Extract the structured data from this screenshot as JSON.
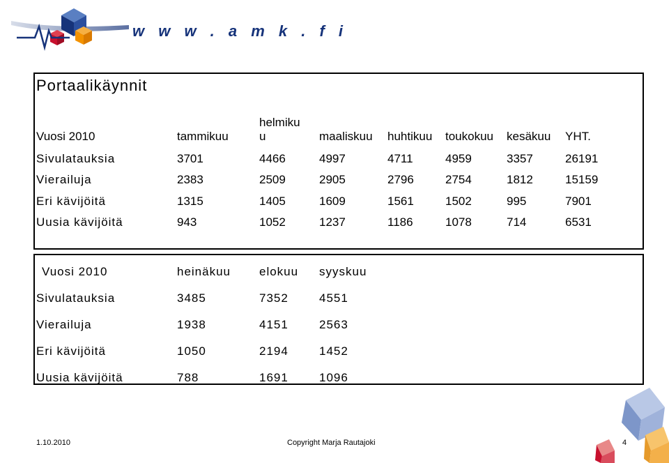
{
  "header": {
    "url": "w w w . a m k . f i"
  },
  "title": "Portaalikäynnit",
  "table1": {
    "headers": [
      "Vuosi 2010",
      "tammikuu",
      "helmiku\nu",
      "maaliskuu",
      "huhtikuu",
      "toukokuu",
      "kesäkuu",
      "YHT."
    ],
    "rows": [
      [
        "Sivulatauksia",
        "3701",
        "4466",
        "4997",
        "4711",
        "4959",
        "3357",
        "26191"
      ],
      [
        "Vierailuja",
        "2383",
        "2509",
        "2905",
        "2796",
        "2754",
        "1812",
        "15159"
      ],
      [
        "Eri kävijöitä",
        "1315",
        "1405",
        "1609",
        "1561",
        "1502",
        "995",
        "7901"
      ],
      [
        "Uusia kävijöitä",
        "943",
        "1052",
        "1237",
        "1186",
        "1078",
        "714",
        "6531"
      ]
    ]
  },
  "table2": {
    "headers": [
      "Vuosi 2010",
      "heinäkuu",
      "elokuu",
      "syyskuu"
    ],
    "rows": [
      [
        "Sivulatauksia",
        "3485",
        "7352",
        "4551"
      ],
      [
        "Vierailuja",
        "1938",
        "4151",
        "2563"
      ],
      [
        "Eri kävijöitä",
        "1050",
        "2194",
        "1452"
      ],
      [
        "Uusia kävijöitä",
        "788",
        "1691",
        "1096"
      ]
    ]
  },
  "footer": {
    "date": "1.10.2010",
    "copyright": "Copyright Marja Rautajoki",
    "page": "4"
  },
  "colors": {
    "logo_blue": "#16337a",
    "logo_red": "#c8102e",
    "logo_orange": "#f39200"
  }
}
